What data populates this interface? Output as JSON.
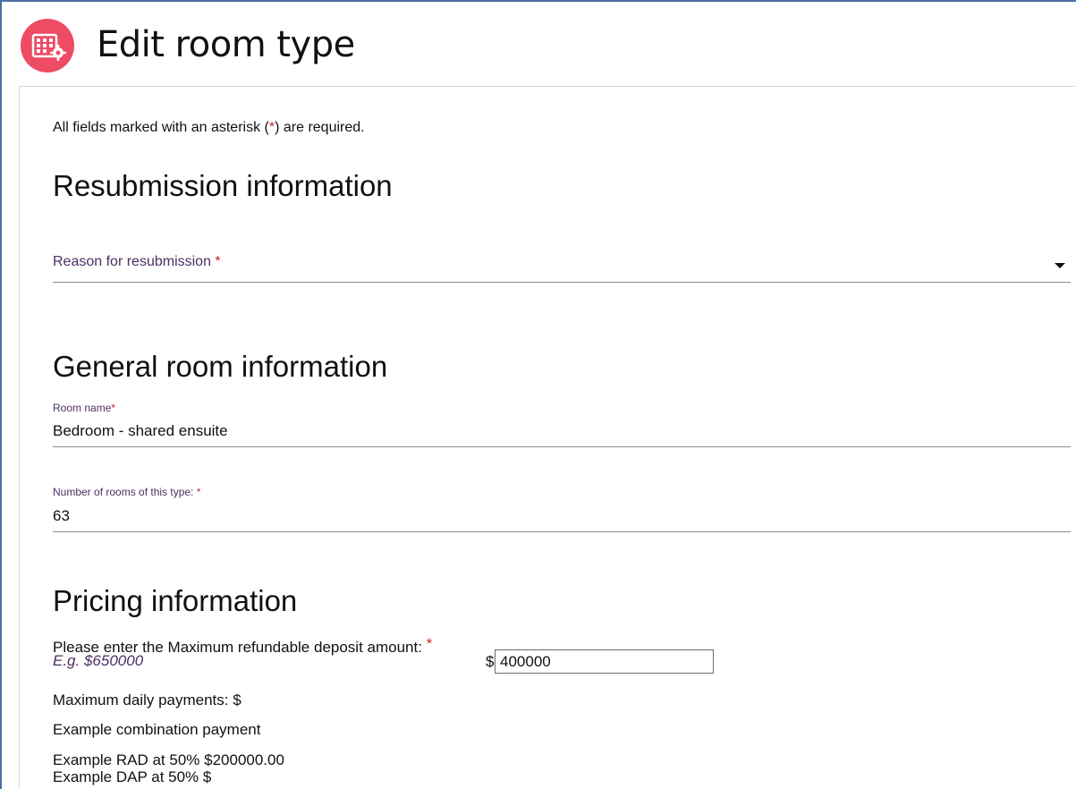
{
  "header": {
    "title": "Edit room type",
    "icon": "room-grid-settings-icon",
    "icon_color": "#ee4b64"
  },
  "form": {
    "required_note_prefix": "All fields marked with an asterisk (",
    "required_note_asterisk": "*",
    "required_note_suffix": ") are required.",
    "asterisk": "*",
    "resubmission": {
      "title": "Resubmission information",
      "reason_label": "Reason for resubmission",
      "reason_value": ""
    },
    "general": {
      "title": "General room information",
      "room_name_label": "Room name",
      "room_name_value": "Bedroom - shared ensuite",
      "room_count_label": "Number of rooms of this type:",
      "room_count_value": "63"
    },
    "pricing": {
      "title": "Pricing information",
      "rad_label": "Please enter the Maximum refundable deposit amount:",
      "rad_hint": "E.g. $650000",
      "currency_symbol": "$",
      "rad_value": "400000",
      "max_daily_payments": "Maximum daily payments: $",
      "example_combination": "Example combination payment",
      "example_rad": "Example RAD at 50% $200000.00",
      "example_dap": "Example DAP at 50% $"
    }
  },
  "colors": {
    "accent": "#ee4b64",
    "label": "#4d2f63",
    "required": "#c62828",
    "frame_border": "#4a6fa5"
  }
}
